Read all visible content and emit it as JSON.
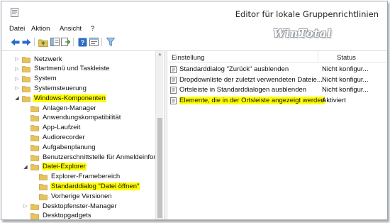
{
  "window": {
    "title": "Editor für lokale Gruppenrichtlinien",
    "watermark": "WinTotal"
  },
  "menu": {
    "items": [
      {
        "label": "Datei"
      },
      {
        "label": "Aktion"
      },
      {
        "label": "Ansicht"
      },
      {
        "label": "?"
      }
    ]
  },
  "toolbar": {
    "buttons": [
      {
        "icon": "back-arrow-icon"
      },
      {
        "icon": "forward-arrow-icon"
      },
      {
        "icon": "up-folder-icon"
      },
      {
        "icon": "show-hide-tree-icon"
      },
      {
        "icon": "export-list-icon"
      },
      {
        "icon": "help-icon"
      },
      {
        "icon": "properties-icon"
      },
      {
        "icon": "filter-icon"
      }
    ]
  },
  "tree": {
    "items": [
      {
        "label": "Netzwerk",
        "expander": "collapsed",
        "highlighted": false
      },
      {
        "label": "Startmenü und Taskleiste",
        "expander": "collapsed",
        "highlighted": false
      },
      {
        "label": "System",
        "expander": "collapsed",
        "highlighted": false
      },
      {
        "label": "Systemsteuerung",
        "expander": "collapsed",
        "highlighted": false
      },
      {
        "label": "Windows-Komponenten",
        "expander": "expanded",
        "highlighted": true
      },
      {
        "label": "Anlagen-Manager",
        "expander": "none",
        "highlighted": false
      },
      {
        "label": "Anwendungskompatibilität",
        "expander": "none",
        "highlighted": false
      },
      {
        "label": "App-Laufzeit",
        "expander": "none",
        "highlighted": false
      },
      {
        "label": "Audiorecorder",
        "expander": "none",
        "highlighted": false
      },
      {
        "label": "Aufgabenplanung",
        "expander": "none",
        "highlighted": false
      },
      {
        "label": "Benutzerschnittstelle für Anmeldeinfon",
        "expander": "none",
        "highlighted": false
      },
      {
        "label": "Datei-Explorer",
        "expander": "expanded",
        "highlighted": true
      },
      {
        "label": "Explorer-Framebereich",
        "expander": "none",
        "highlighted": false
      },
      {
        "label": "Standarddialog \"Datei öffnen\"",
        "expander": "none",
        "highlighted": true,
        "selected": true
      },
      {
        "label": "Vorherige Versionen",
        "expander": "none",
        "highlighted": false
      },
      {
        "label": "Desktopfenster-Manager",
        "expander": "collapsed",
        "highlighted": false
      },
      {
        "label": "Desktopgadgets",
        "expander": "none",
        "highlighted": false
      }
    ]
  },
  "list": {
    "columns": {
      "setting": "Einstellung",
      "status": "Status"
    },
    "rows": [
      {
        "setting": "Standarddialog \"Zurück\" ausblenden",
        "status": "Nicht konfigur...",
        "highlighted": false
      },
      {
        "setting": "Dropdownliste der zuletzt verwendeten Dateie...",
        "status": "Nicht konfigur...",
        "highlighted": false
      },
      {
        "setting": "Ortsleiste in Standarddialogen ausblenden",
        "status": "Nicht konfigur...",
        "highlighted": false
      },
      {
        "setting": "Elemente, die in der Ortsleiste angezeigt werden",
        "status": "Aktiviert",
        "highlighted": true
      }
    ]
  },
  "colors": {
    "highlight": "#ffff00",
    "folder": "#e8c35a",
    "accent_blue": "#2a6dc4"
  }
}
